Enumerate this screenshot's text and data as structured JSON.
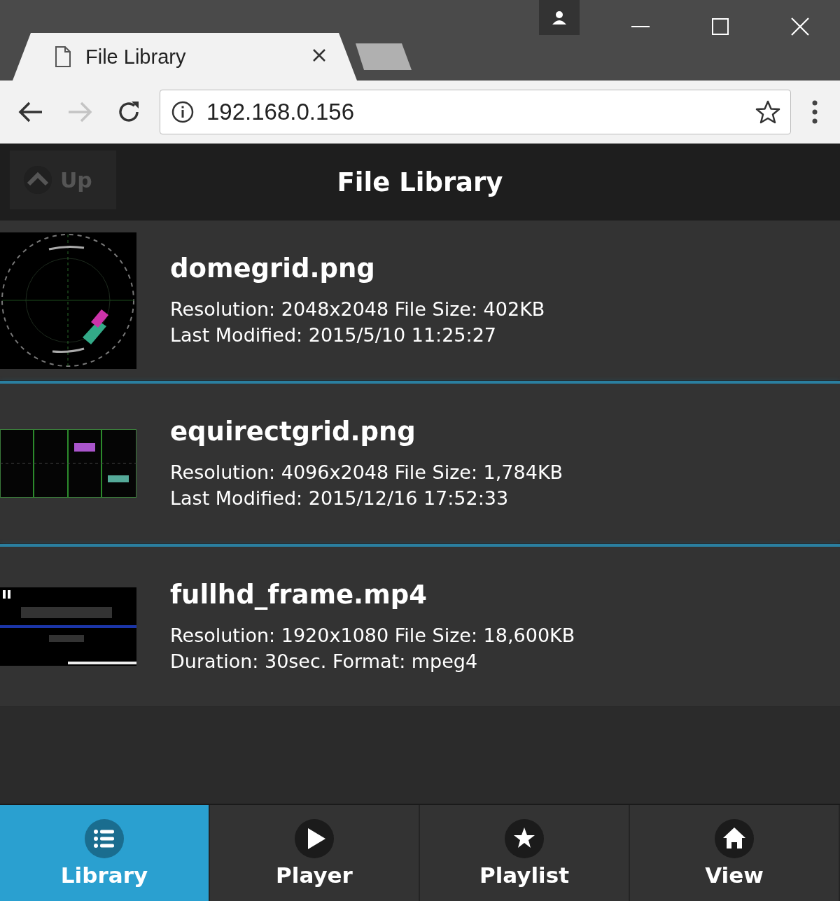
{
  "browser": {
    "tab_title": "File Library",
    "address": "192.168.0.156",
    "forward_disabled": true
  },
  "header": {
    "up_button": "Up",
    "title": "File Library"
  },
  "files": [
    {
      "name": "domegrid.png",
      "details": [
        "Resolution: 2048x2048 File Size: 402KB",
        "Last Modified: 2015/5/10 11:25:27"
      ],
      "thumbnail": {
        "kind": "picture"
      }
    },
    {
      "name": "equirectgrid.png",
      "details": [
        "Resolution: 4096x2048 File Size: 1,784KB",
        "Last Modified: 2015/12/16 17:52:33"
      ],
      "thumbnail": {
        "kind": "picture"
      }
    },
    {
      "name": "fullhd_frame.mp4",
      "details": [
        "Resolution: 1920x1080 File Size: 18,600KB",
        "Duration: 30sec. Format: mpeg4"
      ],
      "thumbnail": {
        "kind": "picture"
      }
    }
  ],
  "nav_tabs": [
    {
      "label": "Library",
      "kind": "list",
      "selected": true
    },
    {
      "label": "Player",
      "kind": "play",
      "selected": false
    },
    {
      "label": "Playlist",
      "kind": "star",
      "selected": false
    },
    {
      "label": "View",
      "kind": "home",
      "selected": false
    }
  ]
}
